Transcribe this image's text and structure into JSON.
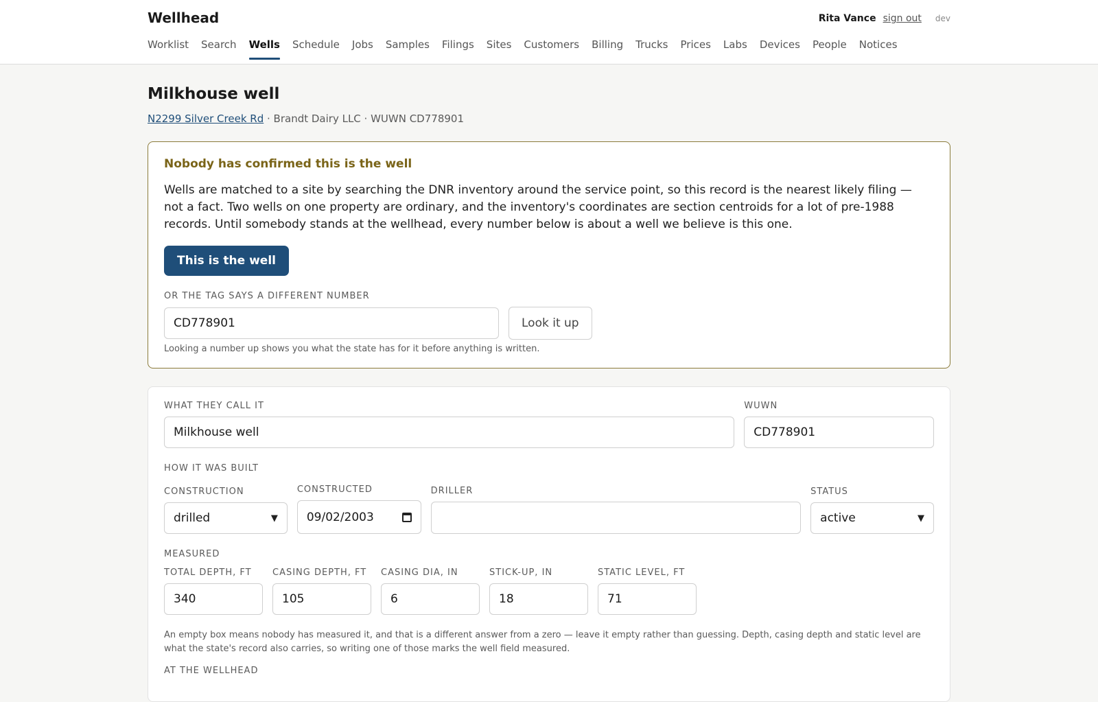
{
  "header": {
    "brand": "Wellhead",
    "user_name": "Rita Vance",
    "sign_out": "sign out",
    "env": "dev"
  },
  "nav": {
    "tabs": [
      {
        "label": "Worklist"
      },
      {
        "label": "Search"
      },
      {
        "label": "Wells",
        "active": true
      },
      {
        "label": "Schedule"
      },
      {
        "label": "Jobs"
      },
      {
        "label": "Samples"
      },
      {
        "label": "Filings"
      },
      {
        "label": "Sites"
      },
      {
        "label": "Customers"
      },
      {
        "label": "Billing"
      },
      {
        "label": "Trucks"
      },
      {
        "label": "Prices"
      },
      {
        "label": "Labs"
      },
      {
        "label": "Devices"
      },
      {
        "label": "People"
      },
      {
        "label": "Notices"
      }
    ]
  },
  "page": {
    "title": "Milkhouse well",
    "address": "N2299 Silver Creek Rd",
    "meta": " · Brandt Dairy LLC · WUWN CD778901"
  },
  "warning": {
    "title": "Nobody has confirmed this is the well",
    "text": "Wells are matched to a site by searching the DNR inventory around the service point, so this record is the nearest likely filing — not a fact. Two wells on one property are ordinary, and the inventory's coordinates are section centroids for a lot of pre-1988 records. Until somebody stands at the wellhead, every number below is about a well we believe is this one.",
    "confirm_button": "This is the well",
    "tag_label": "OR THE TAG SAYS A DIFFERENT NUMBER",
    "tag_value": "CD778901",
    "lookup_button": "Look it up",
    "lookup_hint": "Looking a number up shows you what the state has for it before anything is written."
  },
  "form": {
    "name_label": "WHAT THEY CALL IT",
    "name_value": "Milkhouse well",
    "wuwn_label": "WUWN",
    "wuwn_value": "CD778901",
    "built_heading": "HOW IT WAS BUILT",
    "construction_label": "CONSTRUCTION",
    "construction_value": "drilled",
    "constructed_label": "CONSTRUCTED",
    "constructed_value": "09/02/2003",
    "driller_label": "DRILLER",
    "driller_value": "",
    "status_label": "STATUS",
    "status_value": "active",
    "measured_heading": "MEASURED",
    "measures": [
      {
        "label": "TOTAL DEPTH, FT",
        "value": "340"
      },
      {
        "label": "CASING DEPTH, FT",
        "value": "105"
      },
      {
        "label": "CASING DIA, IN",
        "value": "6"
      },
      {
        "label": "STICK-UP, IN",
        "value": "18"
      },
      {
        "label": "STATIC LEVEL, FT",
        "value": "71"
      }
    ],
    "measured_hint": "An empty box means nobody has measured it, and that is a different answer from a zero — leave it empty rather than guessing. Depth, casing depth and static level are what the state's record also carries, so writing one of those marks the well field measured.",
    "wellhead_heading": "AT THE WELLHEAD"
  }
}
